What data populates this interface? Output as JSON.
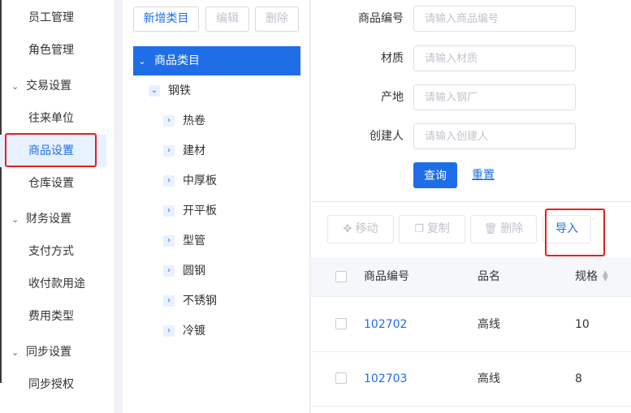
{
  "sidebar": {
    "items": [
      {
        "label": "员工管理",
        "type": "child"
      },
      {
        "label": "角色管理",
        "type": "child"
      },
      {
        "label": "交易设置",
        "type": "group"
      },
      {
        "label": "往来单位",
        "type": "child"
      },
      {
        "label": "商品设置",
        "type": "child",
        "active": true
      },
      {
        "label": "仓库设置",
        "type": "child"
      },
      {
        "label": "财务设置",
        "type": "group"
      },
      {
        "label": "支付方式",
        "type": "child"
      },
      {
        "label": "收付款用途",
        "type": "child"
      },
      {
        "label": "费用类型",
        "type": "child"
      },
      {
        "label": "同步设置",
        "type": "group"
      },
      {
        "label": "同步授权",
        "type": "child"
      }
    ]
  },
  "category": {
    "add_label": "新增类目",
    "edit_label": "编辑",
    "delete_label": "删除",
    "root_label": "商品类目",
    "level1_label": "钢铁",
    "children": [
      "热卷",
      "建材",
      "中厚板",
      "开平板",
      "型管",
      "圆钢",
      "不锈钢",
      "冷镀"
    ]
  },
  "filters": {
    "code_label": "商品编号",
    "code_placeholder": "请输入商品编号",
    "material_label": "材质",
    "material_placeholder": "请输入材质",
    "origin_label": "产地",
    "origin_placeholder": "请输入钢厂",
    "creator_label": "创建人",
    "creator_placeholder": "请输入创建人",
    "query_label": "查询",
    "reset_label": "重置"
  },
  "toolbar": {
    "move_label": "移动",
    "copy_label": "复制",
    "delete_label": "删除",
    "import_label": "导入"
  },
  "table": {
    "columns": [
      "商品编号",
      "品名",
      "规格"
    ],
    "rows": [
      {
        "code": "102702",
        "name": "高线",
        "spec": "10"
      },
      {
        "code": "102703",
        "name": "高线",
        "spec": "8"
      }
    ]
  },
  "colors": {
    "primary": "#1f6ee8",
    "highlight_box": "#e51f1f"
  }
}
